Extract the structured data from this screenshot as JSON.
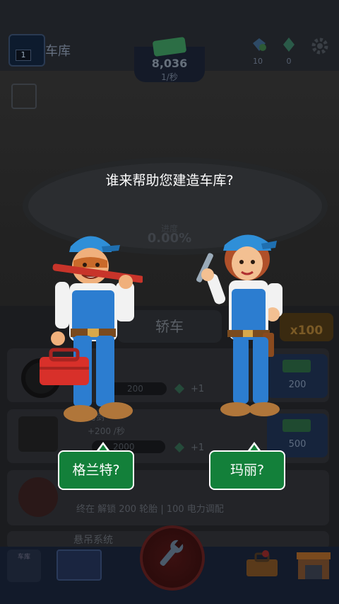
{
  "header": {
    "garage_title": "车库",
    "garage_level": "1",
    "money": "8,036",
    "rate": "1/秒",
    "gem_blue_count": "10",
    "gem_green_count": "0"
  },
  "progress": {
    "label": "进度",
    "percent": "0.00%"
  },
  "dialog": {
    "prompt": "谁来帮助您建造车库?",
    "choice_male": "格兰特?",
    "choice_female": "玛丽?"
  },
  "category": {
    "tab_label": "轿车",
    "multiplier": "x100"
  },
  "upgrades": [
    {
      "bar_value": "200",
      "gem_reward": "+1",
      "buy_price": "200"
    },
    {
      "title": "刀剑",
      "rate": "+200 /秒",
      "bar_value": "2000",
      "gem_reward": "+1",
      "buy_price": "500"
    },
    {
      "requirement": "终在 解锁 200 轮胎 | 100 电力调配"
    },
    {
      "title": "悬吊系统"
    }
  ],
  "bottom_nav": {
    "garage_label": "车库"
  },
  "colors": {
    "bubble_green": "#13803a",
    "cap_blue": "#2f8fd8",
    "overall_blue": "#2c7dd0"
  }
}
